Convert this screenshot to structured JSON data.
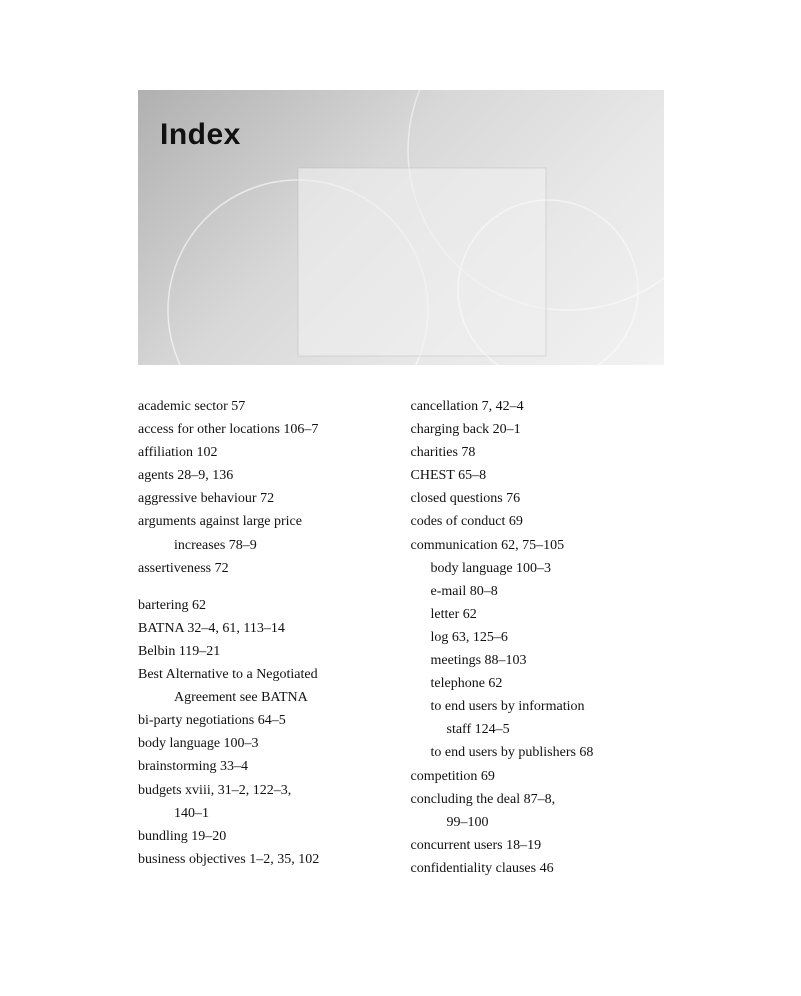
{
  "hero": {
    "title": "Index"
  },
  "left_col": [
    {
      "text": "academic sector 57",
      "indent": 0
    },
    {
      "text": "access for other locations 106–7",
      "indent": 0
    },
    {
      "text": "affiliation 102",
      "indent": 0
    },
    {
      "text": "agents 28–9, 136",
      "indent": 0
    },
    {
      "text": "aggressive behaviour 72",
      "indent": 0
    },
    {
      "text": "arguments against large price",
      "indent": 0
    },
    {
      "text": "increases 78–9",
      "indent": 1
    },
    {
      "text": "assertiveness 72",
      "indent": 0
    },
    {
      "spacer": true
    },
    {
      "text": "bartering 62",
      "indent": 0
    },
    {
      "text": "BATNA 32–4, 61, 113–14",
      "indent": 0
    },
    {
      "text": "Belbin 119–21",
      "indent": 0
    },
    {
      "text": "Best Alternative to a Negotiated",
      "indent": 0
    },
    {
      "text": "Agreement see BATNA",
      "indent": 1
    },
    {
      "text": "bi-party negotiations 64–5",
      "indent": 0
    },
    {
      "text": "body language 100–3",
      "indent": 0
    },
    {
      "text": "brainstorming 33–4",
      "indent": 0
    },
    {
      "text": "budgets xviii, 31–2, 122–3,",
      "indent": 0
    },
    {
      "text": "140–1",
      "indent": 1
    },
    {
      "text": "bundling 19–20",
      "indent": 0
    },
    {
      "text": "business objectives 1–2, 35, 102",
      "indent": 0
    }
  ],
  "right_col": [
    {
      "text": "cancellation 7, 42–4",
      "indent": 0
    },
    {
      "text": "charging back 20–1",
      "indent": 0
    },
    {
      "text": "charities 78",
      "indent": 0
    },
    {
      "text": "CHEST 65–8",
      "indent": 0
    },
    {
      "text": "closed questions 76",
      "indent": 0
    },
    {
      "text": "codes of conduct 69",
      "indent": 0
    },
    {
      "text": "communication 62, 75–105",
      "indent": 0
    },
    {
      "text": "body language 100–3",
      "indent": 2
    },
    {
      "text": "e-mail 80–8",
      "indent": 2
    },
    {
      "text": "letter 62",
      "indent": 2
    },
    {
      "text": "log 63, 125–6",
      "indent": 2
    },
    {
      "text": "meetings 88–103",
      "indent": 2
    },
    {
      "text": "telephone 62",
      "indent": 2
    },
    {
      "text": "to end users by information",
      "indent": 2
    },
    {
      "text": "staff 124–5",
      "indent": 3
    },
    {
      "text": "to end users by publishers 68",
      "indent": 2
    },
    {
      "text": "competition 69",
      "indent": 0
    },
    {
      "text": "concluding the deal 87–8,",
      "indent": 0
    },
    {
      "text": "99–100",
      "indent": 1
    },
    {
      "text": "concurrent users 18–19",
      "indent": 0
    },
    {
      "text": "confidentiality clauses 46",
      "indent": 0
    }
  ]
}
